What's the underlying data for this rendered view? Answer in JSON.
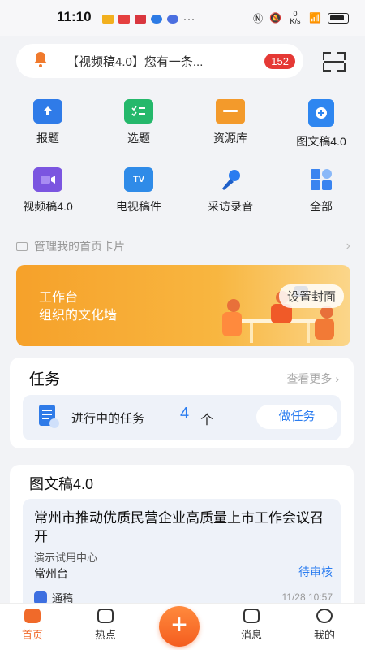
{
  "status_bar": {
    "time": "11:10",
    "network_speed": "0 K/s"
  },
  "notice": {
    "text": "【视频稿4.0】您有一条...",
    "badge": "152",
    "bell_icon": "bell-icon"
  },
  "scan": {
    "icon": "scan-icon"
  },
  "shortcuts": [
    {
      "label": "报题",
      "icon": "report-topic-icon",
      "color": "#2f7be8"
    },
    {
      "label": "选题",
      "icon": "select-topic-icon",
      "color": "#25b86b"
    },
    {
      "label": "资源库",
      "icon": "folder-icon",
      "color": "#f39a2b"
    },
    {
      "label": "图文稿4.0",
      "icon": "doc-plus-icon",
      "color": "#2e86f0"
    },
    {
      "label": "视频稿4.0",
      "icon": "video-camera-icon",
      "color": "#7b55e0"
    },
    {
      "label": "电视稿件",
      "icon": "tv-icon",
      "color": "#2f8be8"
    },
    {
      "label": "采访录音",
      "icon": "microphone-icon",
      "color": "#2a7cf0"
    },
    {
      "label": "全部",
      "icon": "grid-icon",
      "color": "#3a84f0"
    }
  ],
  "manage_cards": {
    "label": "管理我的首页卡片"
  },
  "banner": {
    "title": "工作台",
    "subtitle": "组织的文化墙",
    "button": "设置封面"
  },
  "tasks": {
    "title": "任务",
    "more": "查看更多",
    "in_progress_label": "进行中的任务",
    "count": "4",
    "unit": "个",
    "action": "做任务"
  },
  "article": {
    "heading": "图文稿4.0",
    "title": "常州市推动优质民营企业高质量上市工作会议召开",
    "department": "演示试用中心",
    "station": "常州台",
    "status": "待审核",
    "type": "通稿",
    "time": "11/28 10:57"
  },
  "tabbar": {
    "items": [
      {
        "label": "首页",
        "icon": "home-icon"
      },
      {
        "label": "热点",
        "icon": "hot-icon"
      },
      {
        "label": "消息",
        "icon": "message-icon"
      },
      {
        "label": "我的",
        "icon": "profile-icon"
      }
    ],
    "fab": "+"
  }
}
